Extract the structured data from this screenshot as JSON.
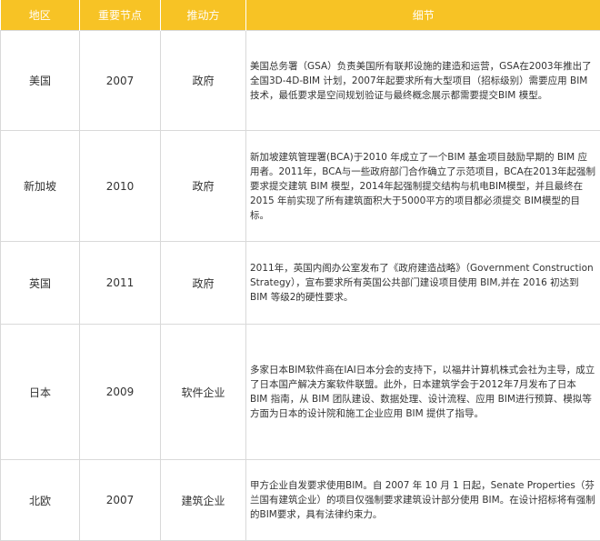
{
  "table": {
    "headers": [
      "地区",
      "重要节点",
      "推动方",
      "细节"
    ],
    "rows": [
      {
        "region": "美国",
        "year": "2007",
        "driver": "政府",
        "detail": "美国总务署（GSA）负责美国所有联邦设施的建造和运营，GSA在2003年推出了全国3D-4D-BIM 计划，2007年起要求所有大型项目（招标级别）需要应用 BIM 技术，最低要求是空间规划验证与最终概念展示都需要提交BIM 模型。"
      },
      {
        "region": "新加坡",
        "year": "2010",
        "driver": "政府",
        "detail": "新加坡建筑管理署(BCA)于2010 年成立了一个BIM 基金项目鼓励早期的 BIM 应用者。2011年，BCA与一些政府部门合作确立了示范项目，BCA在2013年起强制要求提交建筑 BIM 模型，2014年起强制提交结构与机电BIM模型，并且最终在 2015 年前实现了所有建筑面积大于5000平方的项目都必须提交 BIM模型的目标。"
      },
      {
        "region": "英国",
        "year": "2011",
        "driver": "政府",
        "detail": "2011年，英国内阁办公室发布了《政府建造战略》（Government Construction Strategy），宣布要求所有英国公共部门建设项目使用 BIM,并在 2016 初达到BIM 等级2的硬性要求。"
      },
      {
        "region": "日本",
        "year": "2009",
        "driver": "软件企业",
        "detail": "多家日本BIM软件商在IAI日本分会的支持下，以福井计算机株式会社为主导，成立了日本国产解决方案软件联盟。此外，日本建筑学会于2012年7月发布了日本 BIM 指南，从 BIM 团队建设、数据处理、设计流程、应用 BIM进行预算、模拟等方面为日本的设计院和施工企业应用 BIM 提供了指导。"
      },
      {
        "region": "北欧",
        "year": "2007",
        "driver": "建筑企业",
        "detail": "甲方企业自发要求使用BIM。自 2007 年 10 月 1 日起，Senate Properties（芬兰国有建筑企业）的项目仅强制要求建筑设计部分使用 BIM。在设计招标将有强制的BIM要求，具有法律约束力。"
      }
    ]
  }
}
